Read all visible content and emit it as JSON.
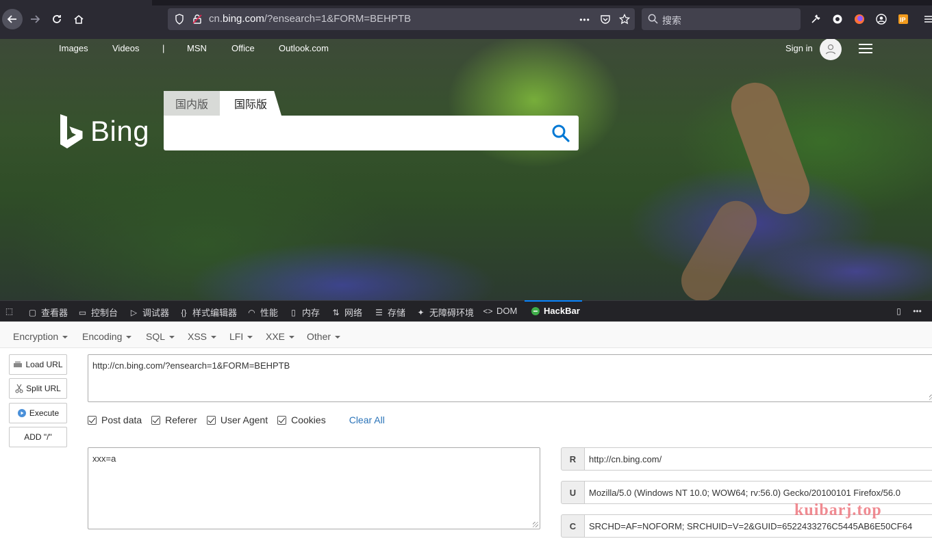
{
  "browser": {
    "url_prefix": "cn.",
    "url_domain": "bing.com",
    "url_path": "/?ensearch=1&FORM=BEHPTB",
    "search_placeholder": "搜索",
    "more_glyph": "•••"
  },
  "bing": {
    "nav": [
      "Images",
      "Videos",
      "|",
      "MSN",
      "Office",
      "Outlook.com"
    ],
    "sign_in": "Sign in",
    "logo": "Bing",
    "tabs": [
      "国内版",
      "国际版"
    ]
  },
  "devtools": {
    "tabs": [
      "查看器",
      "控制台",
      "调试器",
      "样式编辑器",
      "性能",
      "内存",
      "网络",
      "存储",
      "无障碍环境",
      "DOM",
      "HackBar"
    ],
    "active_tab": "HackBar"
  },
  "hackbar": {
    "menus": [
      "Encryption",
      "Encoding",
      "SQL",
      "XSS",
      "LFI",
      "XXE",
      "Other"
    ],
    "buttons": [
      "Load URL",
      "Split URL",
      "Execute",
      "ADD \"/\""
    ],
    "url_value": "http://cn.bing.com/?ensearch=1&FORM=BEHPTB",
    "checks": [
      "Post data",
      "Referer",
      "User Agent",
      "Cookies"
    ],
    "clear_all": "Clear All",
    "post_data": "xxx=a",
    "headers": [
      {
        "label": "R",
        "value": "http://cn.bing.com/"
      },
      {
        "label": "U",
        "value": "Mozilla/5.0 (Windows NT 10.0; WOW64; rv:56.0) Gecko/20100101 Firefox/56.0"
      },
      {
        "label": "C",
        "value": "SRCHD=AF=NOFORM; SRCHUID=V=2&GUID=6522433276C5445AB6E50CF64"
      }
    ],
    "watermark": "kuibarj.top"
  },
  "colors": {
    "accent": "#0a84ff",
    "link": "#2a73b8",
    "bing_blue": "#0078d4"
  }
}
